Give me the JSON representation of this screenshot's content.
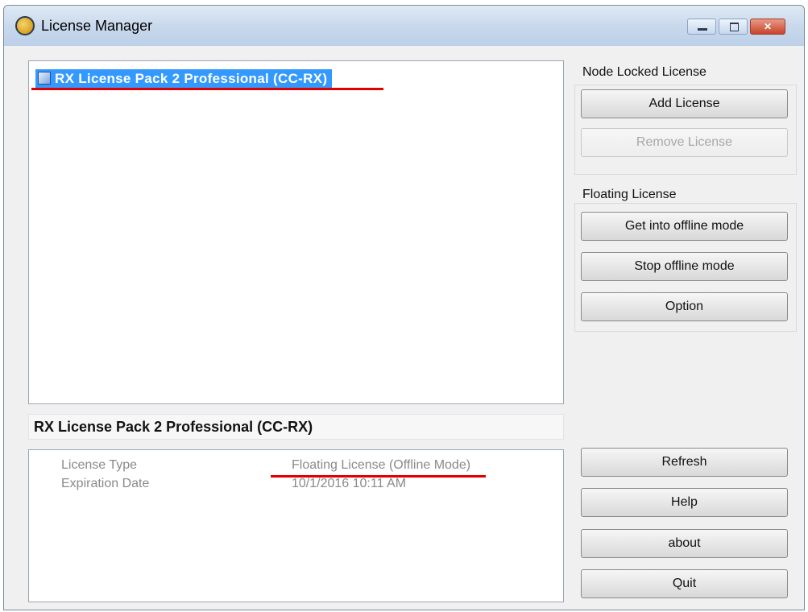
{
  "window": {
    "title": "License Manager",
    "icon": "license-manager-icon",
    "controls": {
      "minimize": "minimize-icon",
      "maximize": "maximize-icon",
      "close": "close-icon"
    }
  },
  "license_list": {
    "items": [
      {
        "label": "RX License Pack 2 Professional (CC-RX)",
        "selected": true,
        "icon": "license-icon"
      }
    ]
  },
  "selected_license": {
    "name": "RX License Pack 2 Professional (CC-RX)",
    "details": [
      {
        "label": "License Type",
        "value": "Floating License (Offline Mode)"
      },
      {
        "label": "Expiration Date",
        "value": "10/1/2016 10:11 AM"
      }
    ]
  },
  "node_locked": {
    "heading": "Node Locked License",
    "add_label": "Add License",
    "remove_label": "Remove License"
  },
  "floating": {
    "heading": "Floating License",
    "offline_label": "Get into offline mode",
    "stop_offline_label": "Stop offline mode",
    "option_label": "Option"
  },
  "footer_buttons": {
    "refresh_label": "Refresh",
    "help_label": "Help",
    "about_label": "about",
    "quit_label": "Quit"
  },
  "colors": {
    "selection": "#3399ff",
    "annotation_underline": "#e00000"
  }
}
